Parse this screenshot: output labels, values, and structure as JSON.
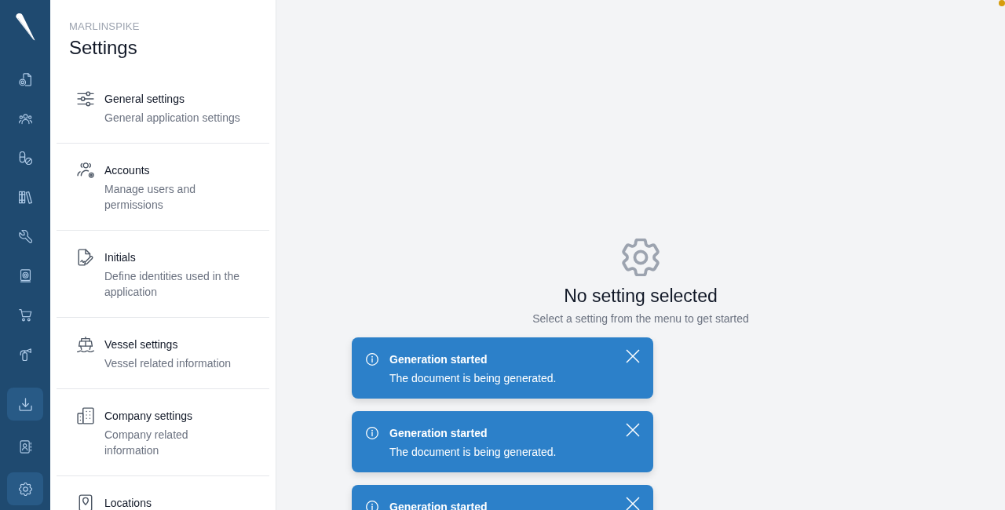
{
  "nav": {
    "items": [
      {
        "kind": "document-badge",
        "selected": false
      },
      {
        "kind": "people",
        "selected": false
      },
      {
        "kind": "pills",
        "selected": false
      },
      {
        "kind": "books",
        "selected": false
      },
      {
        "kind": "wrench",
        "selected": false
      },
      {
        "kind": "manual",
        "selected": false
      },
      {
        "kind": "cart",
        "selected": false
      },
      {
        "kind": "extinguisher",
        "selected": false
      }
    ],
    "bottom_items": [
      {
        "kind": "download",
        "selected": true
      },
      {
        "kind": "contact",
        "selected": false
      },
      {
        "kind": "gear",
        "selected": true
      }
    ]
  },
  "settings_menu": {
    "brand": "MARLINSPIKE",
    "title": "Settings",
    "items": [
      {
        "kind": "sliders",
        "title": "General settings",
        "description": "General application settings",
        "selected": false
      },
      {
        "kind": "users-gear",
        "title": "Accounts",
        "description": "Manage users and permissions",
        "selected": false
      },
      {
        "kind": "document-pen",
        "title": "Initials",
        "description": "Define identities used in the application",
        "selected": false
      },
      {
        "kind": "ship",
        "title": "Vessel settings",
        "description": "Vessel related information",
        "selected": false
      },
      {
        "kind": "buildings",
        "title": "Company settings",
        "description": "Company related information",
        "selected": false
      },
      {
        "kind": "location",
        "title": "Locations",
        "selected": false
      }
    ]
  },
  "empty_state": {
    "title": "No setting selected",
    "message": "Select a setting from the menu to get started"
  },
  "toasts": [
    {
      "title": "Generation started",
      "message": "The document is being generated."
    },
    {
      "title": "Generation started",
      "message": "The document is being generated."
    },
    {
      "title": "Generation started"
    }
  ]
}
